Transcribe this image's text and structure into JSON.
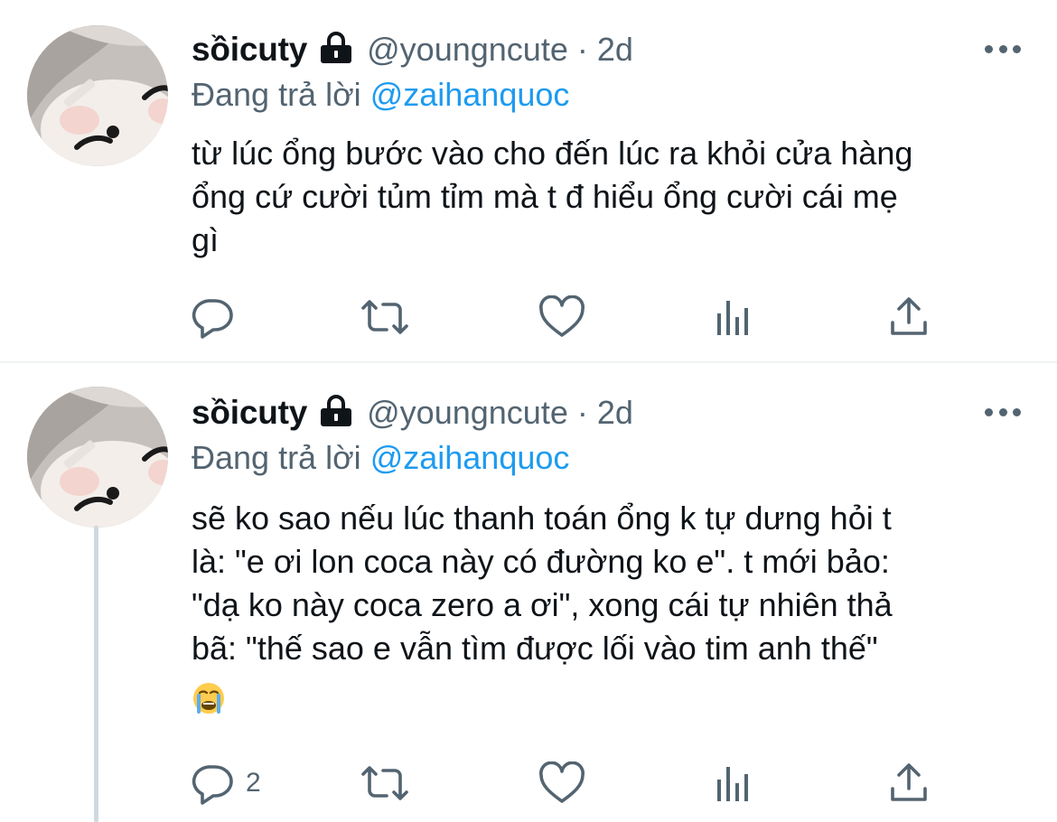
{
  "tweets": [
    {
      "author": {
        "name": "sồicuty",
        "handle": "@youngncute"
      },
      "separator": "·",
      "time": "2d",
      "reply_prefix": "Đang trả lời",
      "reply_mention": "@zaihanquoc",
      "text": "từ lúc ổng bước vào cho đến lúc ra khỏi cửa hàng\nổng cứ cười tủm tỉm mà t đ hiểu ổng cười cái mẹ\ngì",
      "reply_count": "",
      "icons": [
        "lock-icon",
        "more-icon",
        "reply-icon",
        "retweet-icon",
        "like-icon",
        "analytics-icon",
        "share-icon"
      ]
    },
    {
      "author": {
        "name": "sồicuty",
        "handle": "@youngncute"
      },
      "separator": "·",
      "time": "2d",
      "reply_prefix": "Đang trả lời",
      "reply_mention": "@zaihanquoc",
      "text": "sẽ ko sao nếu lúc thanh toán ổng k tự dưng hỏi t\nlà: \"e ơi lon coca này có đường ko e\". t mới bảo:\n\"dạ ko này coca zero a ơi\", xong cái tự nhiên thả\nbã: \"thế sao e vẫn tìm được lối vào tim anh thế\"",
      "emoji": "loudly-crying-face",
      "reply_count": "2",
      "icons": [
        "lock-icon",
        "more-icon",
        "reply-icon",
        "retweet-icon",
        "like-icon",
        "analytics-icon",
        "share-icon"
      ]
    }
  ],
  "colors": {
    "text": "#0f1419",
    "secondary": "#536471",
    "link": "#1d9bf0",
    "divider": "#eff3f4",
    "thread_line": "#cfd9de"
  }
}
